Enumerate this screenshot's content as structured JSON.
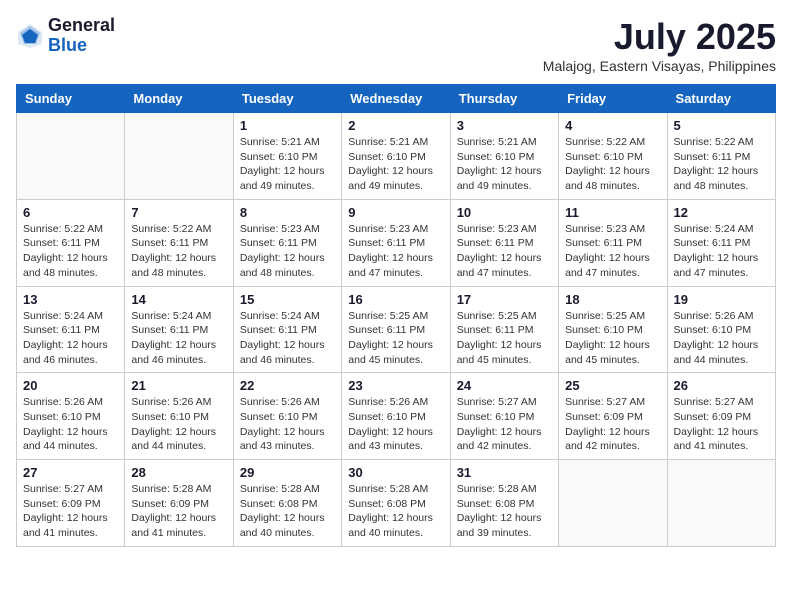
{
  "logo": {
    "general": "General",
    "blue": "Blue"
  },
  "header": {
    "month_year": "July 2025",
    "location": "Malajog, Eastern Visayas, Philippines"
  },
  "days_of_week": [
    "Sunday",
    "Monday",
    "Tuesday",
    "Wednesday",
    "Thursday",
    "Friday",
    "Saturday"
  ],
  "weeks": [
    [
      {
        "day": "",
        "info": ""
      },
      {
        "day": "",
        "info": ""
      },
      {
        "day": "1",
        "info": "Sunrise: 5:21 AM\nSunset: 6:10 PM\nDaylight: 12 hours and 49 minutes."
      },
      {
        "day": "2",
        "info": "Sunrise: 5:21 AM\nSunset: 6:10 PM\nDaylight: 12 hours and 49 minutes."
      },
      {
        "day": "3",
        "info": "Sunrise: 5:21 AM\nSunset: 6:10 PM\nDaylight: 12 hours and 49 minutes."
      },
      {
        "day": "4",
        "info": "Sunrise: 5:22 AM\nSunset: 6:10 PM\nDaylight: 12 hours and 48 minutes."
      },
      {
        "day": "5",
        "info": "Sunrise: 5:22 AM\nSunset: 6:11 PM\nDaylight: 12 hours and 48 minutes."
      }
    ],
    [
      {
        "day": "6",
        "info": "Sunrise: 5:22 AM\nSunset: 6:11 PM\nDaylight: 12 hours and 48 minutes."
      },
      {
        "day": "7",
        "info": "Sunrise: 5:22 AM\nSunset: 6:11 PM\nDaylight: 12 hours and 48 minutes."
      },
      {
        "day": "8",
        "info": "Sunrise: 5:23 AM\nSunset: 6:11 PM\nDaylight: 12 hours and 48 minutes."
      },
      {
        "day": "9",
        "info": "Sunrise: 5:23 AM\nSunset: 6:11 PM\nDaylight: 12 hours and 47 minutes."
      },
      {
        "day": "10",
        "info": "Sunrise: 5:23 AM\nSunset: 6:11 PM\nDaylight: 12 hours and 47 minutes."
      },
      {
        "day": "11",
        "info": "Sunrise: 5:23 AM\nSunset: 6:11 PM\nDaylight: 12 hours and 47 minutes."
      },
      {
        "day": "12",
        "info": "Sunrise: 5:24 AM\nSunset: 6:11 PM\nDaylight: 12 hours and 47 minutes."
      }
    ],
    [
      {
        "day": "13",
        "info": "Sunrise: 5:24 AM\nSunset: 6:11 PM\nDaylight: 12 hours and 46 minutes."
      },
      {
        "day": "14",
        "info": "Sunrise: 5:24 AM\nSunset: 6:11 PM\nDaylight: 12 hours and 46 minutes."
      },
      {
        "day": "15",
        "info": "Sunrise: 5:24 AM\nSunset: 6:11 PM\nDaylight: 12 hours and 46 minutes."
      },
      {
        "day": "16",
        "info": "Sunrise: 5:25 AM\nSunset: 6:11 PM\nDaylight: 12 hours and 45 minutes."
      },
      {
        "day": "17",
        "info": "Sunrise: 5:25 AM\nSunset: 6:11 PM\nDaylight: 12 hours and 45 minutes."
      },
      {
        "day": "18",
        "info": "Sunrise: 5:25 AM\nSunset: 6:10 PM\nDaylight: 12 hours and 45 minutes."
      },
      {
        "day": "19",
        "info": "Sunrise: 5:26 AM\nSunset: 6:10 PM\nDaylight: 12 hours and 44 minutes."
      }
    ],
    [
      {
        "day": "20",
        "info": "Sunrise: 5:26 AM\nSunset: 6:10 PM\nDaylight: 12 hours and 44 minutes."
      },
      {
        "day": "21",
        "info": "Sunrise: 5:26 AM\nSunset: 6:10 PM\nDaylight: 12 hours and 44 minutes."
      },
      {
        "day": "22",
        "info": "Sunrise: 5:26 AM\nSunset: 6:10 PM\nDaylight: 12 hours and 43 minutes."
      },
      {
        "day": "23",
        "info": "Sunrise: 5:26 AM\nSunset: 6:10 PM\nDaylight: 12 hours and 43 minutes."
      },
      {
        "day": "24",
        "info": "Sunrise: 5:27 AM\nSunset: 6:10 PM\nDaylight: 12 hours and 42 minutes."
      },
      {
        "day": "25",
        "info": "Sunrise: 5:27 AM\nSunset: 6:09 PM\nDaylight: 12 hours and 42 minutes."
      },
      {
        "day": "26",
        "info": "Sunrise: 5:27 AM\nSunset: 6:09 PM\nDaylight: 12 hours and 41 minutes."
      }
    ],
    [
      {
        "day": "27",
        "info": "Sunrise: 5:27 AM\nSunset: 6:09 PM\nDaylight: 12 hours and 41 minutes."
      },
      {
        "day": "28",
        "info": "Sunrise: 5:28 AM\nSunset: 6:09 PM\nDaylight: 12 hours and 41 minutes."
      },
      {
        "day": "29",
        "info": "Sunrise: 5:28 AM\nSunset: 6:08 PM\nDaylight: 12 hours and 40 minutes."
      },
      {
        "day": "30",
        "info": "Sunrise: 5:28 AM\nSunset: 6:08 PM\nDaylight: 12 hours and 40 minutes."
      },
      {
        "day": "31",
        "info": "Sunrise: 5:28 AM\nSunset: 6:08 PM\nDaylight: 12 hours and 39 minutes."
      },
      {
        "day": "",
        "info": ""
      },
      {
        "day": "",
        "info": ""
      }
    ]
  ]
}
